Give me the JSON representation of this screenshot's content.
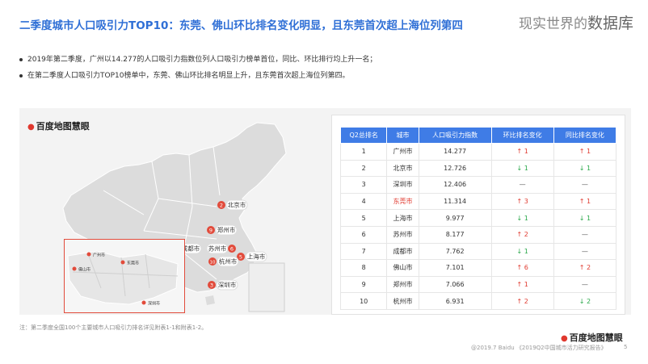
{
  "header": {
    "title": "二季度城市人口吸引力TOP10：东莞、佛山环比排名变化明显，且东莞首次超上海位列第四",
    "brand_small": "现实世界的",
    "brand_big": "数据库"
  },
  "bullets": [
    "2019年第二季度，广州以14.277的人口吸引力指数位列人口吸引力榜单首位，同比、环比排行均上升一名；",
    "在第二季度人口吸引力TOP10榜单中，东莞、佛山环比排名明显上升，且东莞首次超上海位列第四。"
  ],
  "map": {
    "logo": "百度地图慧眼",
    "markers": [
      {
        "rank": "2",
        "name": "北京市"
      },
      {
        "rank": "9",
        "name": "郑州市"
      },
      {
        "rank": "7",
        "name": "成都市"
      },
      {
        "rank": "6",
        "name": "苏州市"
      },
      {
        "rank": "5",
        "name": "上海市"
      },
      {
        "rank": "10",
        "name": "杭州市"
      },
      {
        "rank": "3",
        "name": "深圳市"
      }
    ],
    "inset_labels": [
      "广州市",
      "东莞市",
      "佛山市",
      "深圳市"
    ]
  },
  "table": {
    "headers": [
      "Q2总排名",
      "城市",
      "人口吸引力指数",
      "环比排名变化",
      "同比排名变化"
    ],
    "rows": [
      {
        "rank": "1",
        "city": "广州市",
        "index": "14.277",
        "qoq": "↑ 1",
        "qoq_dir": "up",
        "yoy": "↑ 1",
        "yoy_dir": "up"
      },
      {
        "rank": "2",
        "city": "北京市",
        "index": "12.726",
        "qoq": "↓ 1",
        "qoq_dir": "down",
        "yoy": "↓ 1",
        "yoy_dir": "down"
      },
      {
        "rank": "3",
        "city": "深圳市",
        "index": "12.406",
        "qoq": "—",
        "qoq_dir": "none",
        "yoy": "—",
        "yoy_dir": "none"
      },
      {
        "rank": "4",
        "city": "东莞市",
        "index": "11.314",
        "qoq": "↑ 3",
        "qoq_dir": "up",
        "yoy": "↑ 1",
        "yoy_dir": "up"
      },
      {
        "rank": "5",
        "city": "上海市",
        "index": "9.977",
        "qoq": "↓ 1",
        "qoq_dir": "down",
        "yoy": "↓ 1",
        "yoy_dir": "down"
      },
      {
        "rank": "6",
        "city": "苏州市",
        "index": "8.177",
        "qoq": "↑ 2",
        "qoq_dir": "up",
        "yoy": "—",
        "yoy_dir": "none"
      },
      {
        "rank": "7",
        "city": "成都市",
        "index": "7.762",
        "qoq": "↓ 1",
        "qoq_dir": "down",
        "yoy": "—",
        "yoy_dir": "none"
      },
      {
        "rank": "8",
        "city": "佛山市",
        "index": "7.101",
        "qoq": "↑ 6",
        "qoq_dir": "up",
        "yoy": "↑ 2",
        "yoy_dir": "up"
      },
      {
        "rank": "9",
        "city": "郑州市",
        "index": "7.066",
        "qoq": "↑ 1",
        "qoq_dir": "up",
        "yoy": "—",
        "yoy_dir": "none"
      },
      {
        "rank": "10",
        "city": "杭州市",
        "index": "6.931",
        "qoq": "↑ 2",
        "qoq_dir": "up",
        "yoy": "↓ 2",
        "yoy_dir": "down"
      }
    ]
  },
  "note": "注：第二季度全国100个主要城市人口吸引力排名详见附表1-1和附表1-2。",
  "footer": {
    "logo": "百度地图慧眼",
    "source": "@2019.7 Baidu 《2019Q2中国城市活力研究报告》",
    "page": "5"
  },
  "colors": {
    "title_blue": "#2f6fd6",
    "header_blue": "#3f7ce6",
    "up_red": "#e03a2f",
    "down_green": "#2aa84a",
    "marker_red": "#e24b3b"
  }
}
